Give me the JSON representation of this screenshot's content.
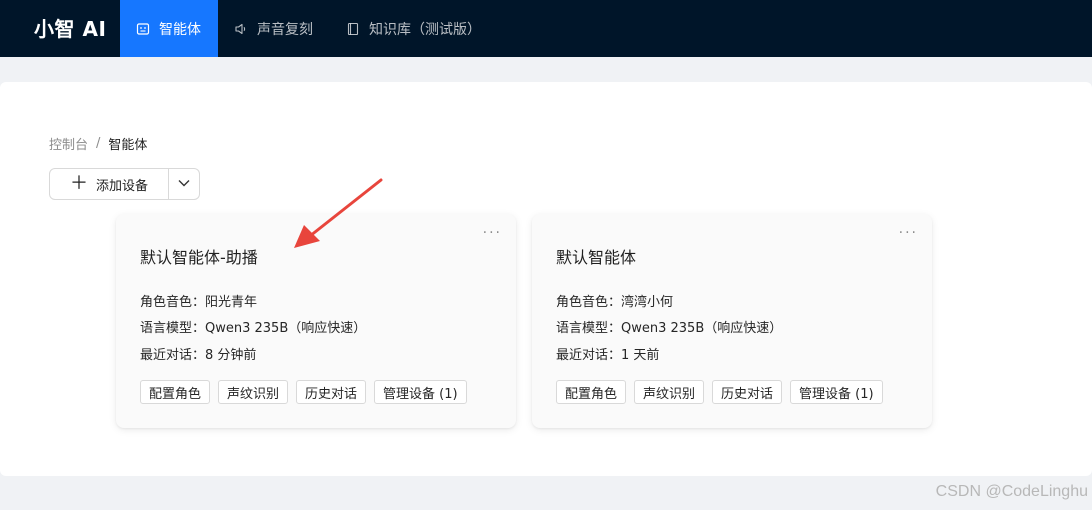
{
  "app": {
    "logo": "小智 AI"
  },
  "nav": [
    {
      "label": "智能体",
      "icon": "robot-icon",
      "active": true
    },
    {
      "label": "声音复刻",
      "icon": "speaker-icon",
      "active": false
    },
    {
      "label": "知识库（测试版）",
      "icon": "book-icon",
      "active": false
    }
  ],
  "breadcrumb": {
    "root": "控制台",
    "sep": "/",
    "current": "智能体"
  },
  "add_button": {
    "label": "添加设备",
    "icon": "plus-icon",
    "dropdown_icon": "chevron-down-icon"
  },
  "agents": [
    {
      "name": "默认智能体-助播",
      "role_voice": "角色音色：阳光青年",
      "model": "语言模型：Qwen3 235B（响应快速）",
      "last_chat": "最近对话：8 分钟前",
      "actions": [
        "配置角色",
        "声纹识别",
        "历史对话",
        "管理设备 (1)"
      ]
    },
    {
      "name": "默认智能体",
      "role_voice": "角色音色：湾湾小何",
      "model": "语言模型：Qwen3 235B（响应快速）",
      "last_chat": "最近对话：1 天前",
      "actions": [
        "配置角色",
        "声纹识别",
        "历史对话",
        "管理设备 (1)"
      ]
    }
  ],
  "more_icon": "···",
  "watermark": "CSDN @CodeLinghu",
  "colors": {
    "topbar": "#001529",
    "accent": "#1677ff",
    "annotation": "#e8453c"
  }
}
